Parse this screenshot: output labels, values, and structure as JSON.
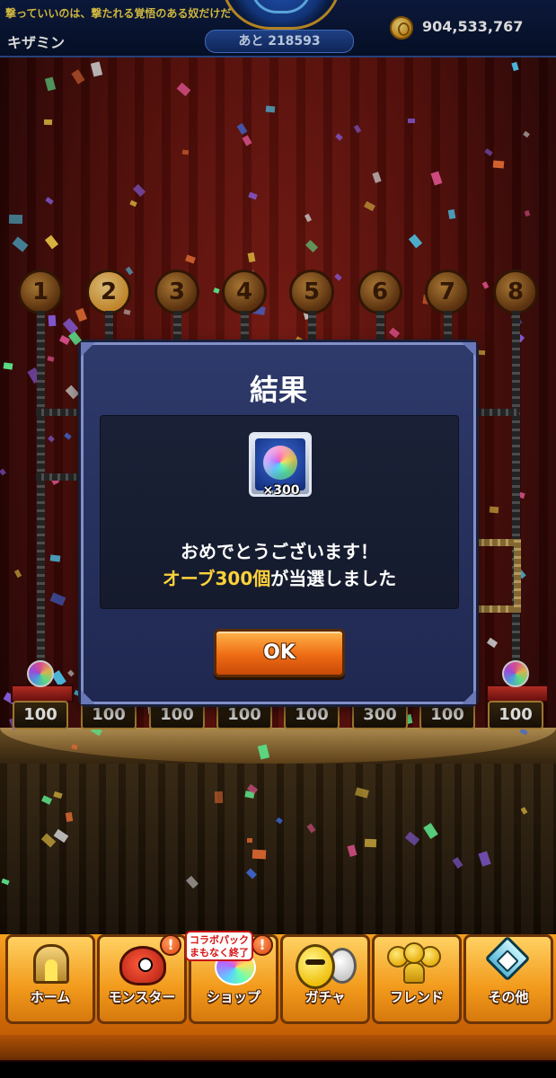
{
  "header": {
    "quote": "撃っていいのは、撃たれる覚悟のある奴だけだ",
    "player_name": "キザミン",
    "remaining_label": "あと 218593",
    "coins": "904,533,767"
  },
  "lanes": [
    {
      "number": "1",
      "prize": "100"
    },
    {
      "number": "2",
      "prize": "100"
    },
    {
      "number": "3",
      "prize": "100"
    },
    {
      "number": "4",
      "prize": "100"
    },
    {
      "number": "5",
      "prize": "100"
    },
    {
      "number": "6",
      "prize": "300"
    },
    {
      "number": "7",
      "prize": "100"
    },
    {
      "number": "8",
      "prize": "100"
    }
  ],
  "dialog": {
    "title": "結果",
    "reward_icon": "rainbow-orb-icon",
    "reward_qty": "×300",
    "congrats": "おめでとうございます！",
    "won_highlight": "オーブ300個",
    "won_rest": "が当選しました",
    "ok_label": "OK"
  },
  "nav": {
    "items": [
      {
        "label": "ホーム",
        "icon": "home-icon"
      },
      {
        "label": "モンスター",
        "icon": "monster-icon"
      },
      {
        "label": "ショップ",
        "icon": "shop-orb-icon"
      },
      {
        "label": "ガチャ",
        "icon": "gacha-egg-icon"
      },
      {
        "label": "フレンド",
        "icon": "friends-icon"
      },
      {
        "label": "その他",
        "icon": "other-icon"
      }
    ],
    "collab_badge_line1": "コラボパック",
    "collab_badge_line2": "まもなく終了",
    "alert_mark": "!"
  },
  "colors": {
    "highlight": "#ffd23a",
    "ok_button": "#ee6b14",
    "dialog_bg": "#2e3a6b"
  }
}
